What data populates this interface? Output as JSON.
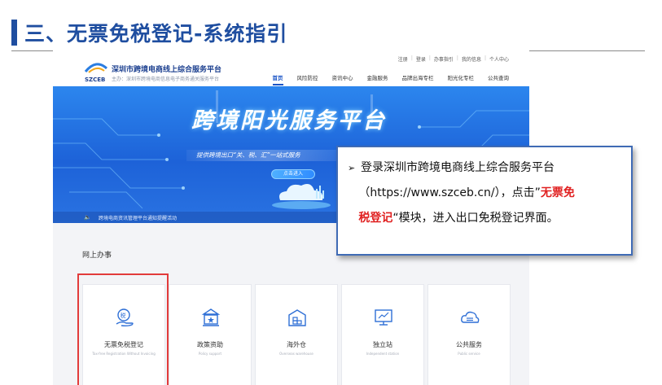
{
  "slide": {
    "heading": "三、无票免税登记-系统指引"
  },
  "site": {
    "logo_text": "SZCEB",
    "title": "深圳市跨境电商线上综合服务平台",
    "subtitle": "主办：深圳市跨境电商信息电子商务通关服务平台",
    "top_links": [
      "注册",
      "登录",
      "办事指引",
      "我的信息",
      "个人中心"
    ],
    "nav": [
      {
        "label": "首页",
        "active": true
      },
      {
        "label": "风险防控",
        "active": false
      },
      {
        "label": "资讯中心",
        "active": false
      },
      {
        "label": "金融服务",
        "active": false
      },
      {
        "label": "品牌出海专栏",
        "active": false
      },
      {
        "label": "阳光化专栏",
        "active": false
      },
      {
        "label": "公共查询",
        "active": false
      }
    ],
    "banner": {
      "title": "跨境阳光服务平台",
      "subtitle": "提供跨境出口“关、税、汇”一站式服务",
      "button": "点击进入",
      "notice_icon": "speaker-icon",
      "notice": "跨境电商资讯管理平台通知提醒活动"
    },
    "services": {
      "title": "网上办事",
      "cards": [
        {
          "label": "无票免税登记",
          "en": "Tax-free Registration Without Invoicing",
          "icon": "tax-free-hand-icon"
        },
        {
          "label": "政策资助",
          "en": "Policy support",
          "icon": "government-building-icon"
        },
        {
          "label": "海外仓",
          "en": "Overseas warehouse",
          "icon": "warehouse-icon"
        },
        {
          "label": "独立站",
          "en": "Independent station",
          "icon": "monitor-icon"
        },
        {
          "label": "公共服务",
          "en": "Public service",
          "icon": "cloud-service-icon"
        }
      ]
    }
  },
  "callout": {
    "bullet": "➢",
    "line1": "登录深圳市跨境电商线上综合服务平台",
    "line2_prefix": "（https://www.szceb.cn/），点击”",
    "highlight_a": "无票免",
    "highlight_b": "税登记",
    "line3_suffix": "“模块，进入出口免税登记界面。"
  },
  "colors": {
    "heading_blue": "#1f4ea0",
    "banner_blue": "#1d62d8",
    "highlight_red": "#e23b3b",
    "callout_border": "#3f6bb5"
  }
}
